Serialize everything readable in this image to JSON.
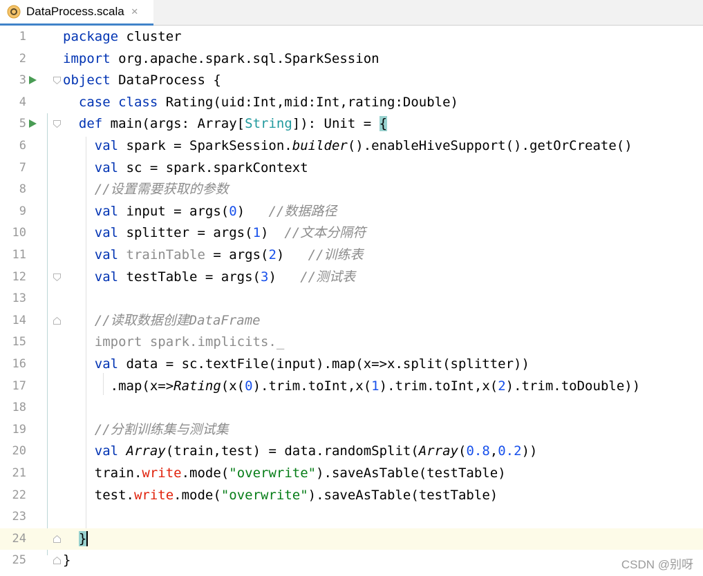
{
  "tab": {
    "title": "DataProcess.scala",
    "close": "×",
    "file_icon": "scala-object-file-icon"
  },
  "colors": {
    "keyword": "#0033b3",
    "comment": "#8c8c8c",
    "number": "#1750eb",
    "string": "#067d17",
    "run": "#499c54"
  },
  "line_numbers": [
    "1",
    "2",
    "3",
    "4",
    "5",
    "6",
    "7",
    "8",
    "9",
    "10",
    "11",
    "12",
    "13",
    "14",
    "15",
    "16",
    "17",
    "18",
    "19",
    "20",
    "21",
    "22",
    "23",
    "24",
    "25"
  ],
  "code": {
    "l1": [
      "package",
      " cluster"
    ],
    "l2": [
      "import",
      " org.apache.spark.sql.SparkSession"
    ],
    "l3": [
      "object",
      " DataProcess {"
    ],
    "l4": [
      "case class",
      " Rating(uid:Int,mid:Int,rating:Double)"
    ],
    "l5": [
      "def",
      " main(args: Array[",
      "String",
      "]): Unit = ",
      "{"
    ],
    "l6": [
      "val",
      " spark = SparkSession.",
      "builder",
      "().enableHiveSupport().getOrCreate()"
    ],
    "l7": [
      "val",
      " sc = spark.sparkContext"
    ],
    "l8": [
      "//设置需要获取的参数"
    ],
    "l9": [
      "val",
      " input = args(",
      "0",
      ")   ",
      "//数据路径"
    ],
    "l10": [
      "val",
      " splitter = args(",
      "1",
      ")  ",
      "//文本分隔符"
    ],
    "l11": [
      "val",
      " ",
      "trainTable",
      " = args(",
      "2",
      ")   ",
      "//训练表"
    ],
    "l12": [
      "val",
      " testTable = args(",
      "3",
      ")   ",
      "//测试表"
    ],
    "l14": [
      "//读取数据创建DataFrame"
    ],
    "l15": [
      "import spark.implicits._"
    ],
    "l16": [
      "val",
      " data = sc.textFile(input).map(x=>x.split(splitter))"
    ],
    "l17": [
      ".map(x=>",
      "Rating",
      "(x(",
      "0",
      ").trim.toInt,x(",
      "1",
      ").trim.toInt,x(",
      "2",
      ").trim.toDouble))"
    ],
    "l19": [
      "//分割训练集与测试集"
    ],
    "l20": [
      "val",
      " ",
      "Array",
      "(train,test) = data.randomSplit(",
      "Array",
      "(",
      "0.8",
      ",",
      "0.2",
      "))"
    ],
    "l21": [
      "train.",
      "write",
      ".mode(",
      "\"overwrite\"",
      ").saveAsTable(testTable)"
    ],
    "l22": [
      "test.",
      "write",
      ".mode(",
      "\"overwrite\"",
      ").saveAsTable(testTable)"
    ],
    "l24": [
      "}"
    ],
    "l25": [
      "}"
    ]
  },
  "watermark": "CSDN @别呀"
}
